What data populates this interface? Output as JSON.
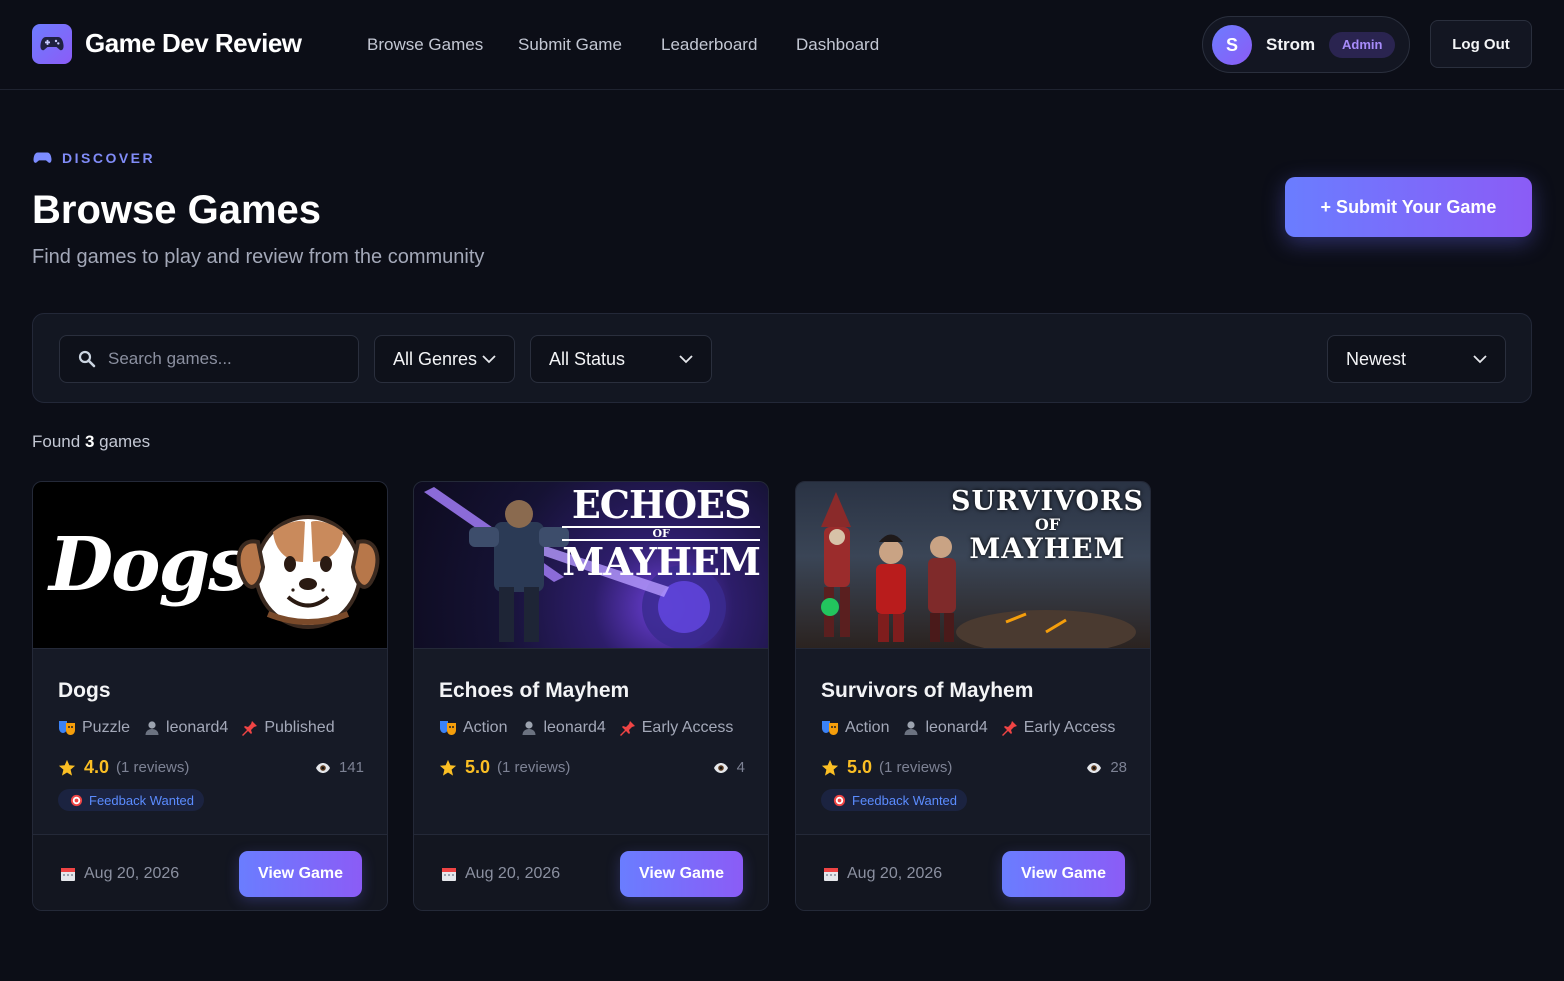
{
  "nav": {
    "brand": "Game Dev Review",
    "links": [
      "Browse Games",
      "Submit Game",
      "Leaderboard",
      "Dashboard"
    ],
    "user": {
      "initial": "S",
      "name": "Strom",
      "role": "Admin"
    },
    "logout": "Log Out"
  },
  "header": {
    "eyebrow": "DISCOVER",
    "title": "Browse Games",
    "subtitle": "Find games to play and review from the community",
    "submit_button": "+ Submit Your Game"
  },
  "filters": {
    "search_placeholder": "Search games...",
    "genre": "All Genres",
    "status": "All Status",
    "sort": "Newest"
  },
  "results": {
    "prefix": "Found",
    "count": "3",
    "suffix": "games"
  },
  "games": [
    {
      "title": "Dogs",
      "genre": "Puzzle",
      "author": "leonard4",
      "status": "Published",
      "rating": "4.0",
      "reviews": "(1 reviews)",
      "views": "141",
      "tag": "Feedback Wanted",
      "date": "Aug 20, 2026",
      "button": "View Game",
      "cover_text": "Dogs"
    },
    {
      "title": "Echoes of Mayhem",
      "genre": "Action",
      "author": "leonard4",
      "status": "Early Access",
      "rating": "5.0",
      "reviews": "(1 reviews)",
      "views": "4",
      "tag": "",
      "date": "Aug 20, 2026",
      "button": "View Game",
      "cover_text": {
        "line1": "ECHOES",
        "line2": "OF",
        "line3": "MAYHEM"
      }
    },
    {
      "title": "Survivors of Mayhem",
      "genre": "Action",
      "author": "leonard4",
      "status": "Early Access",
      "rating": "5.0",
      "reviews": "(1 reviews)",
      "views": "28",
      "tag": "Feedback Wanted",
      "date": "Aug 20, 2026",
      "button": "View Game",
      "cover_text": {
        "line1": "SURVIVORS",
        "line2": "OF",
        "line3": "MAYHEM"
      }
    }
  ],
  "colors": {
    "accent": "#6a7dff",
    "accent2": "#8b5cf6",
    "star": "#fbbf24",
    "bg": "#0c0e17"
  }
}
